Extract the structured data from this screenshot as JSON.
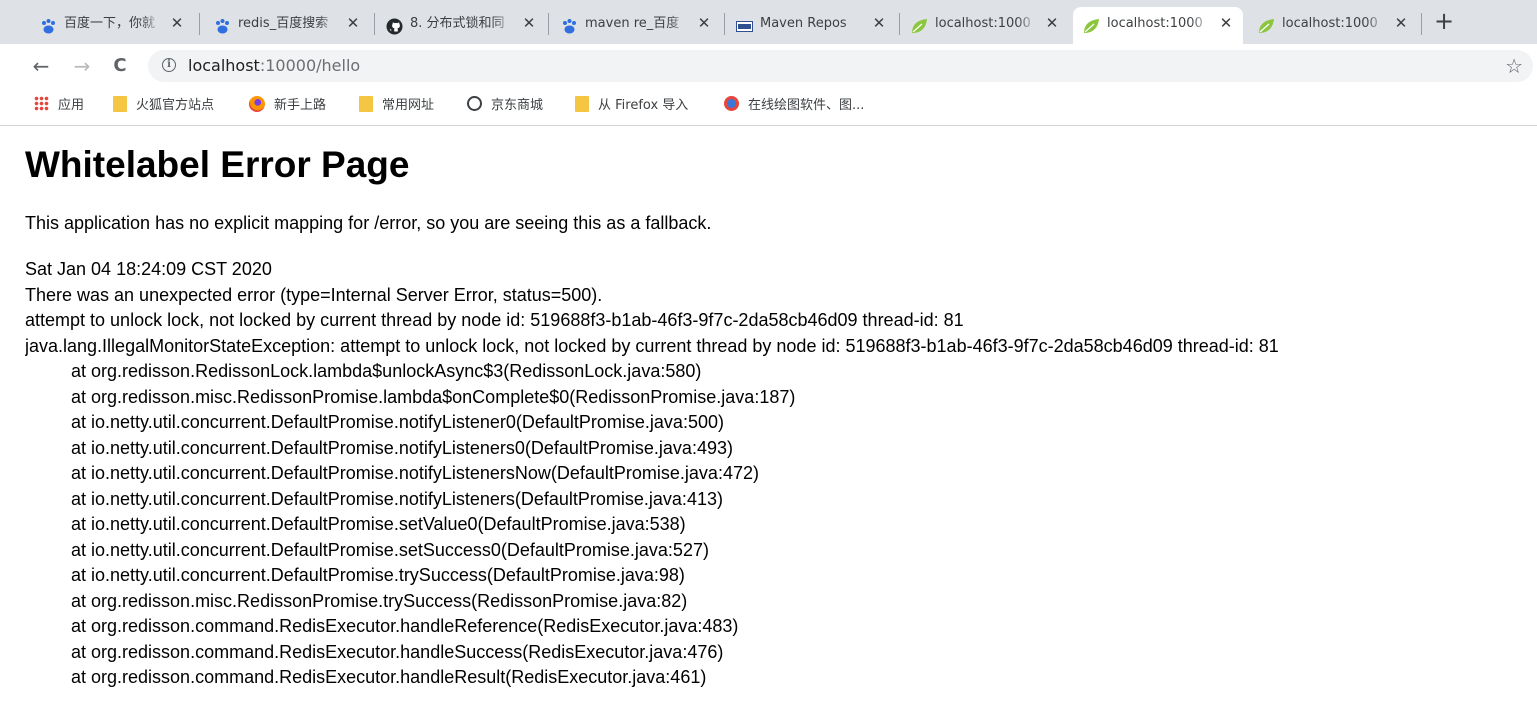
{
  "tabs": [
    {
      "title": "百度一下，你就",
      "icon": "baidu-paw-icon",
      "active": false
    },
    {
      "title": "redis_百度搜索",
      "icon": "baidu-paw-icon",
      "active": false
    },
    {
      "title": "8. 分布式锁和同",
      "icon": "github-icon",
      "active": false
    },
    {
      "title": "maven re_百度",
      "icon": "baidu-paw-icon",
      "active": false
    },
    {
      "title": "Maven Repos",
      "icon": "maven-icon",
      "active": false
    },
    {
      "title": "localhost:1000",
      "icon": "spring-leaf-icon",
      "active": false
    },
    {
      "title": "localhost:1000",
      "icon": "spring-leaf-icon",
      "active": true
    },
    {
      "title": "localhost:1000",
      "icon": "spring-leaf-icon",
      "active": false
    }
  ],
  "tab_close_glyph": "✕",
  "new_tab_glyph": "+",
  "toolbar": {
    "back_glyph": "←",
    "forward_glyph": "→",
    "reload_glyph": "C",
    "info_glyph": "i",
    "url_host": "localhost",
    "url_rest": ":10000/hello",
    "star_glyph": "☆"
  },
  "bookmarks": [
    {
      "label": "应用",
      "icon": "apps-grid-icon"
    },
    {
      "label": "火狐官方站点",
      "icon": "folder-icon"
    },
    {
      "label": "新手上路",
      "icon": "firefox-icon"
    },
    {
      "label": "常用网址",
      "icon": "folder-icon"
    },
    {
      "label": "京东商城",
      "icon": "jd-globe-icon"
    },
    {
      "label": "从 Firefox 导入",
      "icon": "folder-icon"
    },
    {
      "label": "在线绘图软件、图...",
      "icon": "drawing-app-icon"
    }
  ],
  "page": {
    "title": "Whitelabel Error Page",
    "explanation": "This application has no explicit mapping for /error, so you are seeing this as a fallback.",
    "timestamp": "Sat Jan 04 18:24:09 CST 2020",
    "error_line": "There was an unexpected error (type=Internal Server Error, status=500).",
    "message": "attempt to unlock lock, not locked by current thread by node id: 519688f3-b1ab-46f3-9f7c-2da58cb46d09 thread-id: 81",
    "exception": "java.lang.IllegalMonitorStateException: attempt to unlock lock, not locked by current thread by node id: 519688f3-b1ab-46f3-9f7c-2da58cb46d09 thread-id: 81",
    "stack_trace": [
      "at org.redisson.RedissonLock.lambda$unlockAsync$3(RedissonLock.java:580)",
      "at org.redisson.misc.RedissonPromise.lambda$onComplete$0(RedissonPromise.java:187)",
      "at io.netty.util.concurrent.DefaultPromise.notifyListener0(DefaultPromise.java:500)",
      "at io.netty.util.concurrent.DefaultPromise.notifyListeners0(DefaultPromise.java:493)",
      "at io.netty.util.concurrent.DefaultPromise.notifyListenersNow(DefaultPromise.java:472)",
      "at io.netty.util.concurrent.DefaultPromise.notifyListeners(DefaultPromise.java:413)",
      "at io.netty.util.concurrent.DefaultPromise.setValue0(DefaultPromise.java:538)",
      "at io.netty.util.concurrent.DefaultPromise.setSuccess0(DefaultPromise.java:527)",
      "at io.netty.util.concurrent.DefaultPromise.trySuccess(DefaultPromise.java:98)",
      "at org.redisson.misc.RedissonPromise.trySuccess(RedissonPromise.java:82)",
      "at org.redisson.command.RedisExecutor.handleReference(RedisExecutor.java:483)",
      "at org.redisson.command.RedisExecutor.handleSuccess(RedisExecutor.java:476)",
      "at org.redisson.command.RedisExecutor.handleResult(RedisExecutor.java:461)"
    ]
  }
}
